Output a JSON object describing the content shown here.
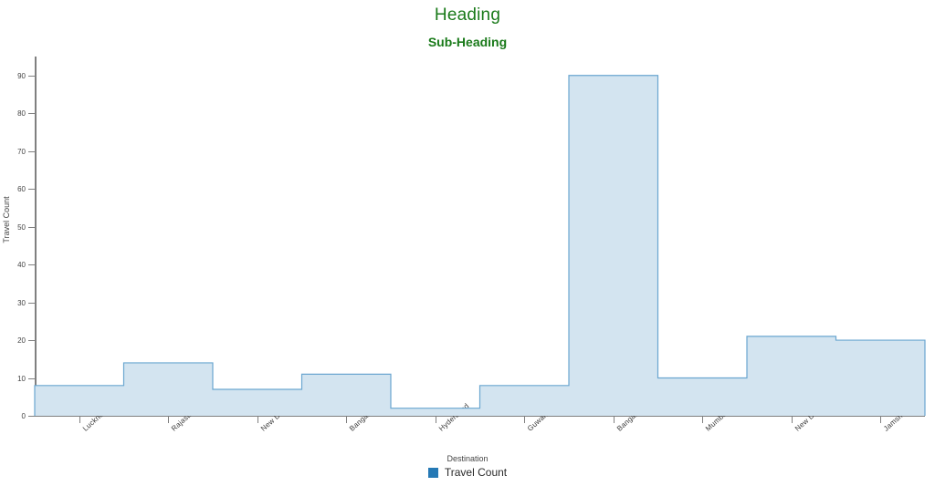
{
  "chart_data": {
    "type": "area",
    "title": "Heading",
    "subtitle": "Sub-Heading",
    "xlabel": "Destination",
    "ylabel": "Travel Count",
    "ylim": [
      0,
      95
    ],
    "yticks": [
      0,
      10,
      20,
      30,
      40,
      50,
      60,
      70,
      80,
      90
    ],
    "grid": false,
    "step": "step-post",
    "legend_position": "bottom-center",
    "categories": [
      "Lucknow",
      "Rajasthan",
      "New Delhi",
      "Bangalore",
      "Hyderabad",
      "Guwahati",
      "Bangalore",
      "Mumbai",
      "New Delhi",
      "Jamshedpur"
    ],
    "series": [
      {
        "name": "Travel Count",
        "values": [
          8,
          14,
          7,
          11,
          2,
          8,
          90,
          10,
          21,
          20
        ],
        "fill_color": "#d3e4f0",
        "line_color": "#6aa6d0",
        "legend_color": "#2579b5"
      }
    ]
  },
  "legend": {
    "entries": [
      {
        "label": "Travel Count",
        "color": "#2579b5"
      }
    ]
  },
  "colors": {
    "title": "#1a7a1a",
    "subtitle": "#1a7a1a",
    "axis": "#808080",
    "area_fill": "#d3e4f0",
    "area_stroke": "#6aa6d0",
    "legend_swatch": "#2579b5"
  }
}
